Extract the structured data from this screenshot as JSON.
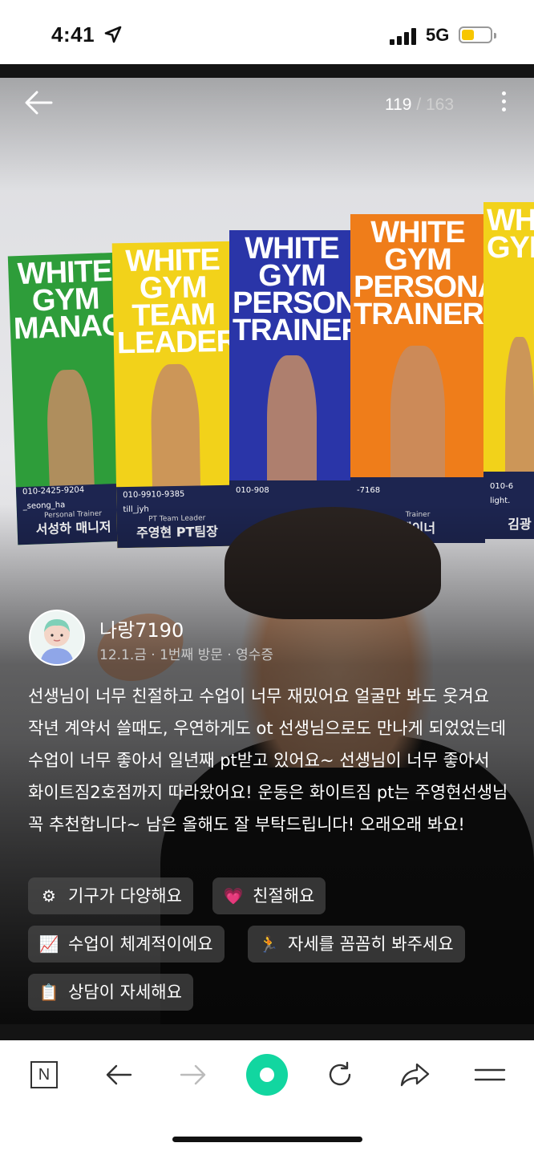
{
  "status_bar": {
    "time": "4:41",
    "network": "5G",
    "battery_level": 0.45,
    "battery_color": "#f7c600"
  },
  "viewer": {
    "counter_current": "119",
    "counter_separator": " / ",
    "counter_total": "163",
    "back_icon": "arrow-left-icon",
    "more_icon": "more-vertical-icon"
  },
  "posters": [
    {
      "headline": "WHITE GYM MANAGER",
      "phone": "010-2425-9204",
      "ig": "_seong_ha",
      "role": "Personal Trainer",
      "name": "서성하 매니저",
      "color": "#2e9d3a"
    },
    {
      "headline": "WHITE GYM TEAM LEADER",
      "phone": "010-9910-9385",
      "ig": "till_jyh",
      "role": "PT Team Leader",
      "name": "주영현 PT팀장",
      "color": "#f2d21a"
    },
    {
      "headline": "WHITE GYM PERSONAL TRAINER",
      "phone": "010-908",
      "ig": "",
      "role": "",
      "name": "",
      "color": "#2a35a8"
    },
    {
      "headline": "WHITE GYM PERSONAL TRAINER",
      "phone": "-7168",
      "ig": "",
      "role": "Trainer",
      "name": "레이너",
      "color": "#ef7d1a"
    },
    {
      "headline": "WHITE GYM",
      "phone": "010-6",
      "ig": "light.",
      "role": "",
      "name": "김광",
      "color": "#f2d21a"
    }
  ],
  "poster_brand": "White Gym",
  "review": {
    "username": "나랑7190",
    "meta": "12.1.금 · 1번째 방문 · 영수증",
    "text": "선생님이 너무 친절하고 수업이 너무 재밌어요 얼굴만 봐도 웃겨요 작년 계약서 쓸때도, 우연하게도 ot 선생님으로도 만나게 되었었는데 수업이 너무 좋아서 일년째 pt받고 있어요~ 선생님이 너무 좋아서 화이트짐2호점까지 따라왔어요! 운동은 화이트짐 pt는 주영현선생님 꼭 추천합니다~ 남은 올해도 잘 부탁드립니다! 오래오래 봐요!",
    "tags": [
      {
        "emoji": "⚙",
        "label": "기구가 다양해요"
      },
      {
        "emoji": "💗",
        "label": "친절해요"
      },
      {
        "emoji": "📈",
        "label": "수업이 체계적이에요"
      },
      {
        "emoji": "🏃",
        "label": "자세를 꼼꼼히 봐주세요"
      },
      {
        "emoji": "📋",
        "label": "상담이 자세해요"
      }
    ]
  },
  "toolbar": {
    "home_label": "N",
    "icons": [
      "n-logo-icon",
      "back-arrow-icon",
      "forward-arrow-icon",
      "green-dot-icon",
      "refresh-icon",
      "share-icon",
      "menu-icon"
    ],
    "accent": "#12d6a0"
  }
}
